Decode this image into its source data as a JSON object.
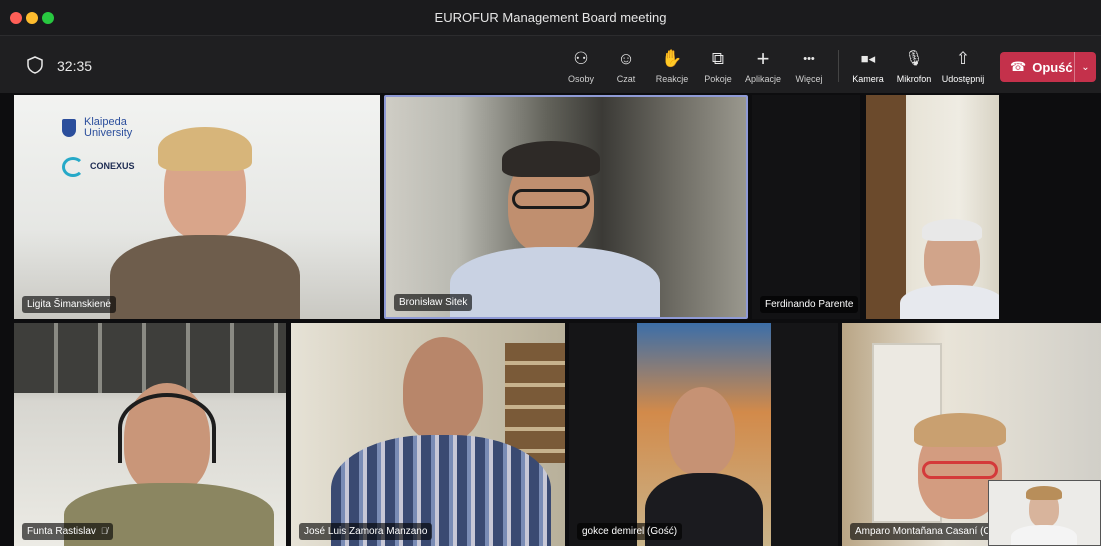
{
  "window": {
    "title": "EUROFUR Management Board meeting"
  },
  "toolbar": {
    "timer": "32:35",
    "buttons": [
      {
        "label": "Osoby",
        "icon": "people-icon",
        "glyph": "⚇"
      },
      {
        "label": "Czat",
        "icon": "chat-icon",
        "glyph": "☺"
      },
      {
        "label": "Reakcje",
        "icon": "reactions-icon",
        "glyph": "✋"
      },
      {
        "label": "Pokoje",
        "icon": "rooms-icon",
        "glyph": "⧉"
      },
      {
        "label": "Aplikacje",
        "icon": "plus-icon",
        "glyph": "+"
      },
      {
        "label": "Więcej",
        "icon": "more-icon",
        "glyph": "•••"
      }
    ],
    "media": [
      {
        "label": "Kamera",
        "icon": "camera-icon",
        "glyph": "■◂"
      },
      {
        "label": "Mikrofon",
        "icon": "microphone-icon",
        "glyph": "🎙"
      },
      {
        "label": "Udostępnij",
        "icon": "share-icon",
        "glyph": "⇧"
      }
    ],
    "leave": {
      "label": "Opuść",
      "phone_glyph": "☎",
      "caret_glyph": "⌄"
    }
  },
  "participants": [
    {
      "name": "Ligita Šimanskienė",
      "muted": false
    },
    {
      "name": "Bronisław Sitek",
      "muted": false
    },
    {
      "name": "Ferdinando Parente",
      "muted": false
    },
    {
      "name": "Funta Rastislav",
      "muted": true
    },
    {
      "name": "José Luis Zamora Manzano",
      "muted": false
    },
    {
      "name": "gokce demirel (Gość)",
      "muted": false
    },
    {
      "name": "Amparo Montañana Casaní (C",
      "muted": false
    }
  ],
  "logos": {
    "university": "Klaipeda University",
    "conexus": "CONEXUS"
  },
  "colors": {
    "leave": "#c4314b",
    "active_speaker": "#8f9ad6"
  }
}
